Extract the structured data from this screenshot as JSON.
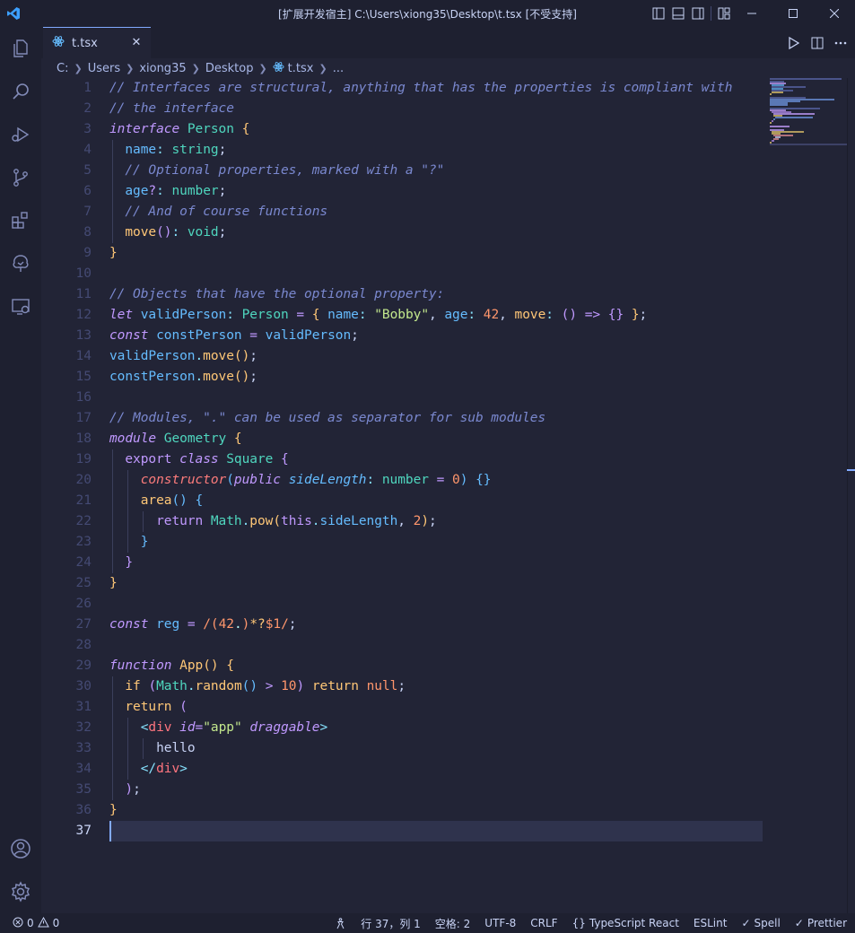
{
  "window": {
    "title": "[扩展开发宿主] C:\\Users\\xiong35\\Desktop\\t.tsx [不受支持]"
  },
  "activity_bar": {
    "items": [
      "explorer-icon",
      "search-icon",
      "run-debug-icon",
      "source-control-icon",
      "extensions-icon",
      "tree-icon",
      "remote-explorer-icon"
    ],
    "bottom": [
      "account-icon",
      "settings-gear-icon"
    ]
  },
  "tab": {
    "label": "t.tsx",
    "icon": "react-icon"
  },
  "breadcrumb": [
    "C:",
    "Users",
    "xiong35",
    "Desktop",
    "t.tsx",
    "..."
  ],
  "editor": {
    "line_numbers": [
      "1",
      "2",
      "3",
      "4",
      "5",
      "6",
      "7",
      "8",
      "9",
      "10",
      "11",
      "12",
      "13",
      "14",
      "15",
      "16",
      "17",
      "18",
      "19",
      "20",
      "21",
      "22",
      "23",
      "24",
      "25",
      "26",
      "27",
      "28",
      "29",
      "30",
      "31",
      "32",
      "33",
      "34",
      "35",
      "36",
      "37"
    ],
    "active_line": "37"
  },
  "status_bar": {
    "errors": "0",
    "warnings": "0",
    "position": "行 37，列 1",
    "spaces": "空格: 2",
    "encoding": "UTF-8",
    "eol": "CRLF",
    "language": "TypeScript React",
    "eslint": "ESLint",
    "spell": "Spell",
    "prettier": "Prettier"
  },
  "colors": {
    "background": "#222436",
    "chrome": "#1e2030",
    "accent": "#82aaff"
  }
}
